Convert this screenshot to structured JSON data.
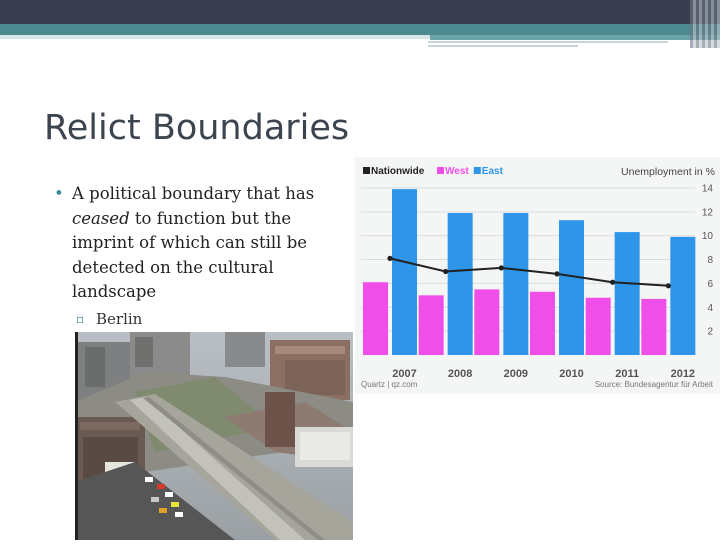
{
  "slide": {
    "title": "Relict Boundaries",
    "bullets": [
      {
        "pre": "A political boundary that has ",
        "italic": "ceased",
        "post": " to function but the imprint of which can still be detected on the cultural landscape",
        "sub": [
          "Berlin"
        ]
      }
    ]
  },
  "chart_data": {
    "type": "bar",
    "title": "Unemployment in %",
    "legend": [
      "Nationwide",
      "West",
      "East"
    ],
    "legend_placement": "top-left",
    "categories": [
      "2007",
      "2008",
      "2009",
      "2010",
      "2011",
      "2012"
    ],
    "series": [
      {
        "name": "Nationwide",
        "type": "line",
        "values": [
          8.1,
          7.0,
          7.3,
          6.8,
          6.1,
          5.8
        ]
      },
      {
        "name": "West",
        "type": "bar",
        "values": [
          6.1,
          5.0,
          5.5,
          5.3,
          4.8,
          4.7
        ]
      },
      {
        "name": "East",
        "type": "bar",
        "values": [
          13.9,
          11.9,
          11.9,
          11.3,
          10.3,
          9.9
        ]
      }
    ],
    "yticks": [
      "14",
      "12",
      "10",
      "8",
      "6",
      "4",
      "2"
    ],
    "ylim": [
      0,
      14.5
    ],
    "grid": true,
    "source_left": "Quartz | qz.com",
    "source_right": "Source: Bundesagentur für Arbeit",
    "colors": {
      "nationwide": "#222222",
      "west": "#f04ee8",
      "east": "#2f95e8"
    }
  }
}
